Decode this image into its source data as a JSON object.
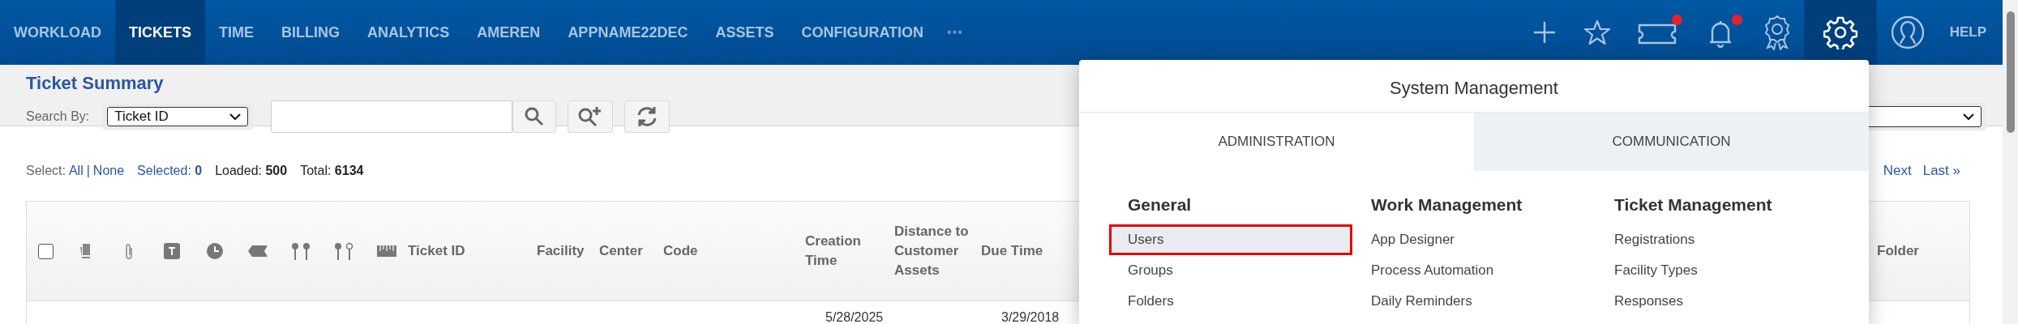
{
  "nav": {
    "items": [
      {
        "label": "WORKLOAD",
        "selected": false
      },
      {
        "label": "TICKETS",
        "selected": true
      },
      {
        "label": "TIME",
        "selected": false
      },
      {
        "label": "BILLING",
        "selected": false
      },
      {
        "label": "ANALYTICS",
        "selected": false
      },
      {
        "label": "AMEREN",
        "selected": false
      },
      {
        "label": "APPNAME22DEC",
        "selected": false
      },
      {
        "label": "ASSETS",
        "selected": false
      },
      {
        "label": "CONFIGURATION",
        "selected": false
      }
    ],
    "more": "•••",
    "tools": [
      {
        "kind": "plus",
        "badge": false,
        "selected": false
      },
      {
        "kind": "star",
        "badge": false,
        "selected": false
      },
      {
        "kind": "ticket",
        "badge": true,
        "selected": false
      },
      {
        "kind": "bell",
        "badge": true,
        "selected": false
      },
      {
        "kind": "award",
        "badge": false,
        "selected": false
      },
      {
        "kind": "gear",
        "badge": false,
        "selected": true
      },
      {
        "kind": "user",
        "badge": false,
        "selected": false
      }
    ],
    "help": "HELP"
  },
  "summary": {
    "title": "Ticket Summary",
    "search_label": "Search By:",
    "search_by": "Ticket ID",
    "select_label": "Select:",
    "all": "All",
    "separator": "|",
    "none": "None",
    "selected": "Selected: **0**",
    "loaded": "Loaded: **500**",
    "total": "Total: **6134**",
    "pagination": [
      "Next",
      "Last »"
    ]
  },
  "table": {
    "select_all_checked": false,
    "columns": [
      "Ticket ID",
      "Facility",
      "Center",
      "Code",
      "Creation Time",
      "Distance to Customer Assets",
      "Due Time",
      "Folder"
    ],
    "rows": [
      {
        "creation_time": "5/28/2025",
        "due_time": "3/29/2018"
      }
    ]
  },
  "panel": {
    "title": "System Management",
    "tabs": [
      {
        "label": "ADMINISTRATION",
        "selected": true
      },
      {
        "label": "COMMUNICATION",
        "selected": false
      }
    ],
    "sections": [
      {
        "heading": "General",
        "items": [
          {
            "label": "Users",
            "selected": true
          },
          {
            "label": "Groups",
            "selected": false
          },
          {
            "label": "Folders",
            "selected": false
          }
        ]
      },
      {
        "heading": "Work Management",
        "items": [
          {
            "label": "App Designer",
            "selected": false
          },
          {
            "label": "Process Automation",
            "selected": false
          },
          {
            "label": "Daily Reminders",
            "selected": false
          }
        ]
      },
      {
        "heading": "Ticket Management",
        "items": [
          {
            "label": "Registrations",
            "selected": false
          },
          {
            "label": "Facility Types",
            "selected": false
          },
          {
            "label": "Responses",
            "selected": false
          }
        ]
      }
    ]
  }
}
